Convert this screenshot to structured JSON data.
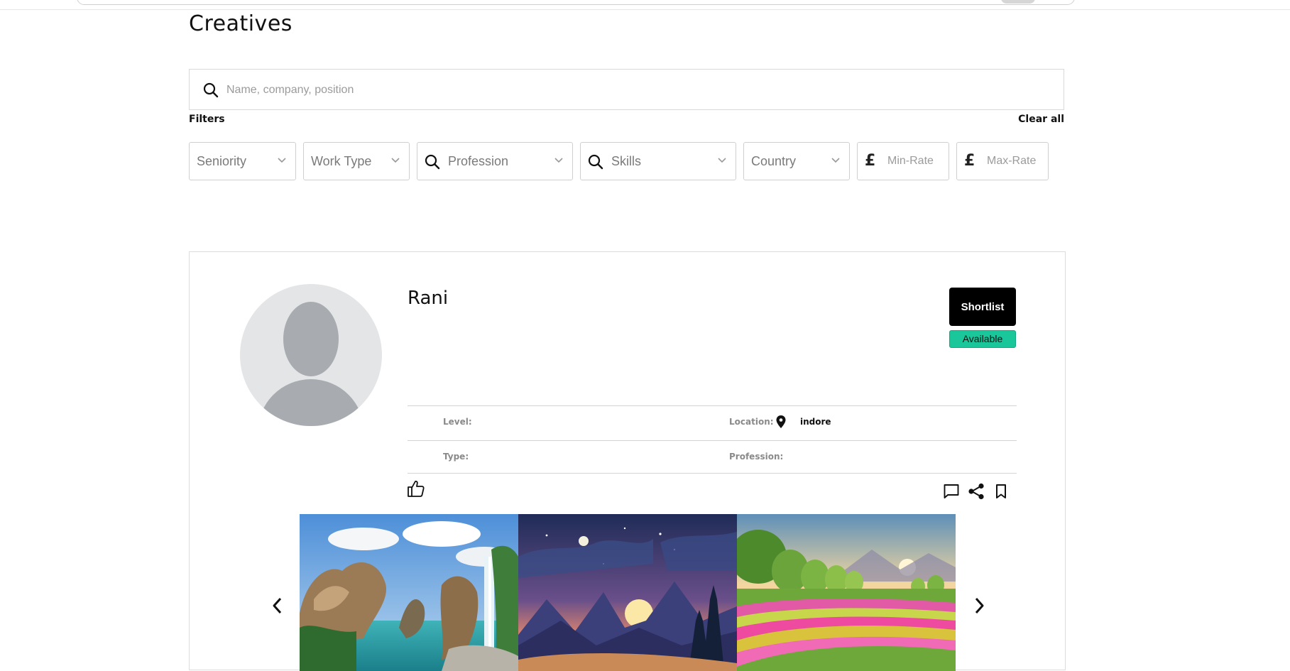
{
  "page": {
    "title": "Creatives"
  },
  "search": {
    "placeholder": "Name, company, position",
    "value": ""
  },
  "filters": {
    "label": "Filters",
    "clear_label": "Clear all",
    "seniority": "Seniority",
    "work_type": "Work Type",
    "profession": "Profession",
    "skills": "Skills",
    "country": "Country",
    "min_rate_placeholder": "Min-Rate",
    "max_rate_placeholder": "Max-Rate",
    "currency_symbol": "£"
  },
  "creative": {
    "name": "Rani",
    "shortlist_label": "Shortlist",
    "status": "Available",
    "status_color": "#19c79a",
    "fields": {
      "level_label": "Level:",
      "level_value": "",
      "location_label": "Location:",
      "location_value": "indore",
      "type_label": "Type:",
      "type_value": "",
      "profession_label": "Profession:",
      "profession_value": ""
    },
    "actions": {
      "like_icon": "thumbs-up-icon",
      "comment_icon": "comment-icon",
      "share_icon": "share-icon",
      "bookmark_icon": "bookmark-icon"
    },
    "gallery": {
      "prev_icon": "chevron-left-icon",
      "next_icon": "chevron-right-icon",
      "slides": [
        "rocky coast waterfall",
        "moonlit mountains sunset",
        "flower field sunrise"
      ]
    }
  }
}
